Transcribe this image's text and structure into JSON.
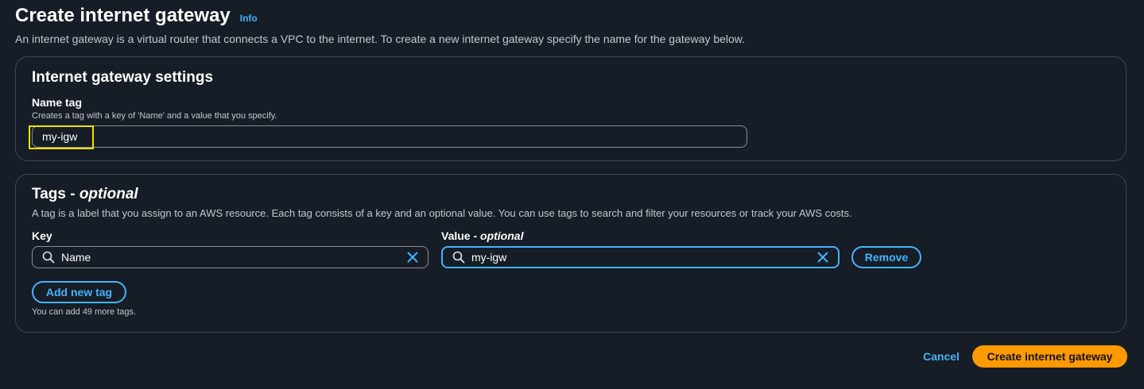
{
  "header": {
    "title": "Create internet gateway",
    "info_label": "Info",
    "description": "An internet gateway is a virtual router that connects a VPC to the internet. To create a new internet gateway specify the name for the gateway below."
  },
  "settings_panel": {
    "title": "Internet gateway settings",
    "name_tag": {
      "label": "Name tag",
      "description": "Creates a tag with a key of 'Name' and a value that you specify.",
      "value": "my-igw"
    }
  },
  "tags_panel": {
    "title_main": "Tags - ",
    "title_optional": "optional",
    "description": "A tag is a label that you assign to an AWS resource. Each tag consists of a key and an optional value. You can use tags to search and filter your resources or track your AWS costs.",
    "key_label": "Key",
    "value_label_main": "Value - ",
    "value_label_optional": "optional",
    "tags": [
      {
        "key": "Name",
        "value": "my-igw"
      }
    ],
    "remove_label": "Remove",
    "add_label": "Add new tag",
    "hint": "You can add 49 more tags."
  },
  "footer": {
    "cancel_label": "Cancel",
    "submit_label": "Create internet gateway"
  },
  "icons": {
    "search": "search-icon",
    "clear": "close-icon"
  },
  "colors": {
    "background": "#161d26",
    "accent": "#42b4ff",
    "primary_button": "#ff9900",
    "highlight": "#f2e400",
    "border": "#424650"
  }
}
